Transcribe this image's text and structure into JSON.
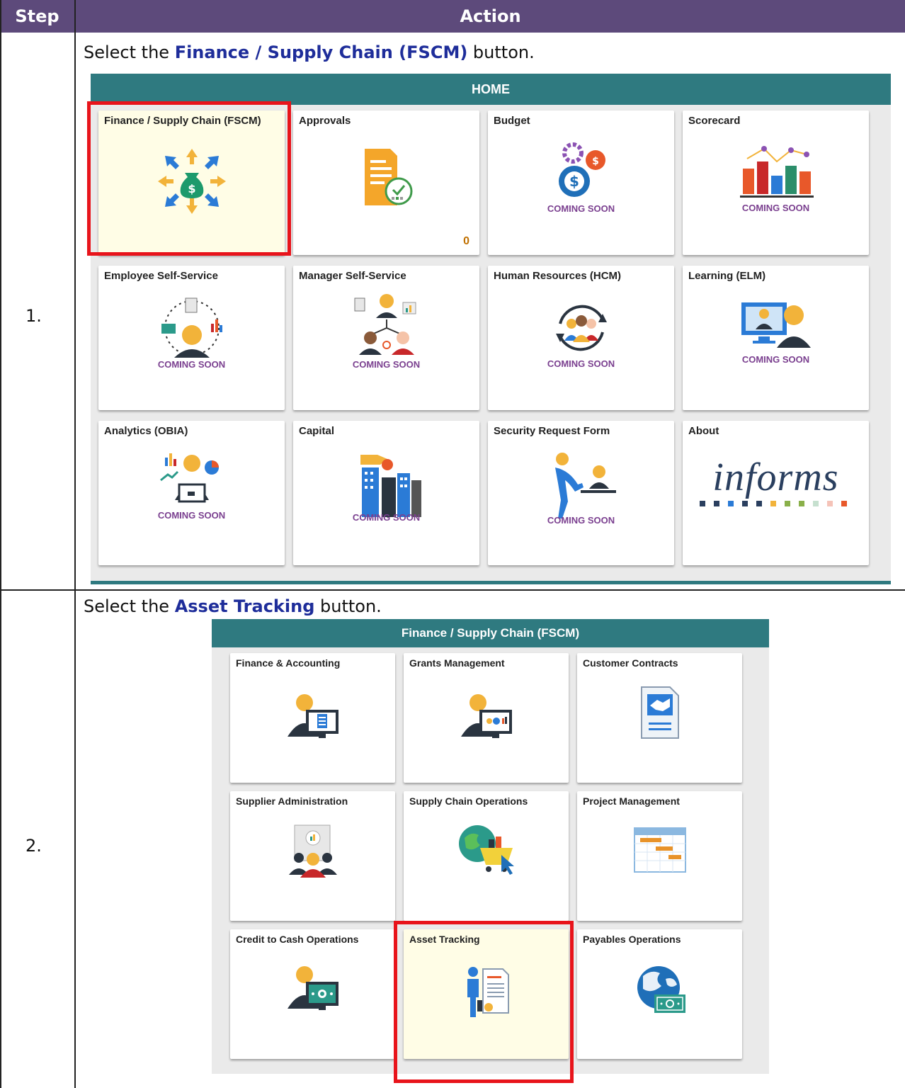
{
  "table": {
    "header_step": "Step",
    "header_action": "Action",
    "rows": [
      {
        "number": "1.",
        "instr_pre": "Select the ",
        "instr_bold": "Finance / Supply Chain (FSCM)",
        "instr_post": " button."
      },
      {
        "number": "2.",
        "instr_pre": "Select the ",
        "instr_bold": "Asset Tracking",
        "instr_post": " button."
      }
    ]
  },
  "home": {
    "title": "HOME",
    "tiles": [
      {
        "label": "Finance / Supply Chain (FSCM)",
        "icon": "money-bag-arrows-icon",
        "highlight": true
      },
      {
        "label": "Approvals",
        "icon": "approval-document-icon",
        "badge": "0"
      },
      {
        "label": "Budget",
        "icon": "dollar-gears-icon",
        "status": "COMING SOON"
      },
      {
        "label": "Scorecard",
        "icon": "bar-chart-scorecard-icon",
        "status": "COMING SOON"
      },
      {
        "label": "Employee Self-Service",
        "icon": "employee-cycle-icon",
        "status": "COMING SOON"
      },
      {
        "label": "Manager Self-Service",
        "icon": "manager-org-chart-icon",
        "status": "COMING SOON"
      },
      {
        "label": "Human Resources (HCM)",
        "icon": "people-circle-icon",
        "status": "COMING SOON"
      },
      {
        "label": "Learning (ELM)",
        "icon": "person-monitor-icon",
        "status": "COMING SOON"
      },
      {
        "label": "Analytics (OBIA)",
        "icon": "analytics-person-icon",
        "status": "COMING SOON"
      },
      {
        "label": "Capital",
        "icon": "buildings-hand-icon",
        "status": "COMING SOON"
      },
      {
        "label": "Security Request Form",
        "icon": "person-desk-icon",
        "status": "COMING SOON"
      },
      {
        "label": "About",
        "icon": "informs-logo",
        "logo_text": "informs"
      }
    ]
  },
  "fscm": {
    "title": "Finance / Supply Chain (FSCM)",
    "tiles": [
      {
        "label": "Finance & Accounting",
        "icon": "person-document-monitor-icon"
      },
      {
        "label": "Grants Management",
        "icon": "person-grants-monitor-icon"
      },
      {
        "label": "Customer Contracts",
        "icon": "handshake-contract-icon"
      },
      {
        "label": "Supplier Administration",
        "icon": "supplier-people-icon"
      },
      {
        "label": "Supply Chain Operations",
        "icon": "globe-cart-icon"
      },
      {
        "label": "Project Management",
        "icon": "gantt-chart-icon"
      },
      {
        "label": "Credit to Cash Operations",
        "icon": "person-cash-monitor-icon"
      },
      {
        "label": "Asset Tracking",
        "icon": "person-certificate-icon",
        "highlight": true
      },
      {
        "label": "Payables Operations",
        "icon": "globe-money-icon"
      }
    ]
  },
  "colors": {
    "header": "#5d4a7b",
    "banner": "#2f7a80",
    "highlight_border": "#e8141b",
    "instruction_bold": "#1e2d9a"
  }
}
